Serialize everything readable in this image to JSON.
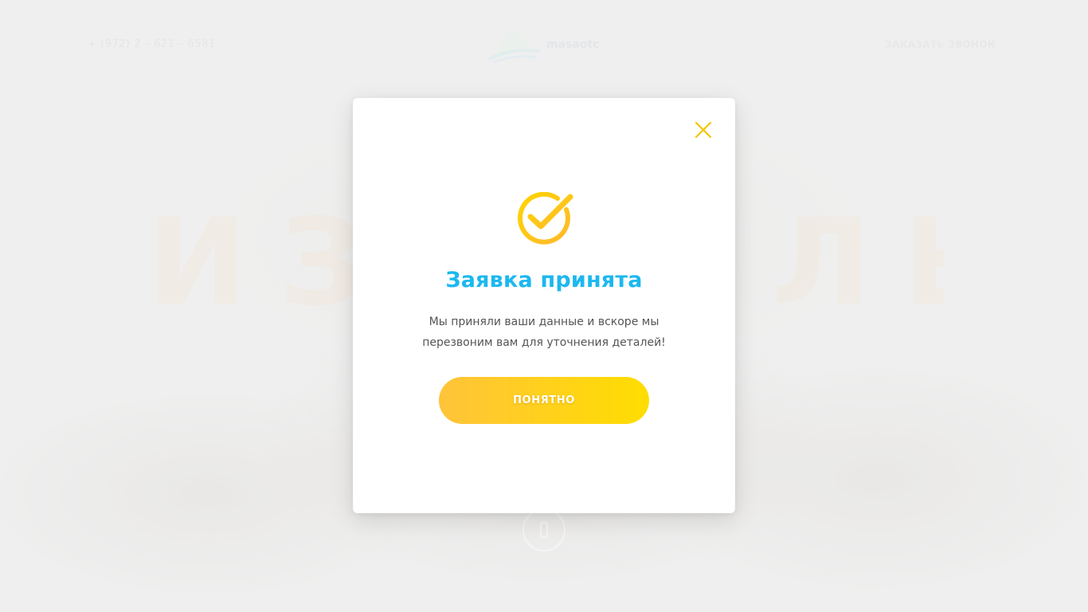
{
  "background": {
    "phone": "+ (972) 2 – 621 – 6581",
    "logo_text": "masaotc",
    "callback_label": "ЗАКАЗАТЬ ЗВОНОК",
    "hero_text": "ИЗРАИЛЬ"
  },
  "modal": {
    "title": "Заявка принята",
    "message_line1": "Мы приняли ваши данные и вскоре мы",
    "message_line2": "перезвоним вам для уточнения деталей!",
    "button_label": "Понятно",
    "close_icon": "close-icon",
    "success_icon": "check-circle-icon"
  },
  "colors": {
    "title": "#1cb8ef",
    "accent_yellow": "#ffd21a",
    "text": "#555555"
  }
}
